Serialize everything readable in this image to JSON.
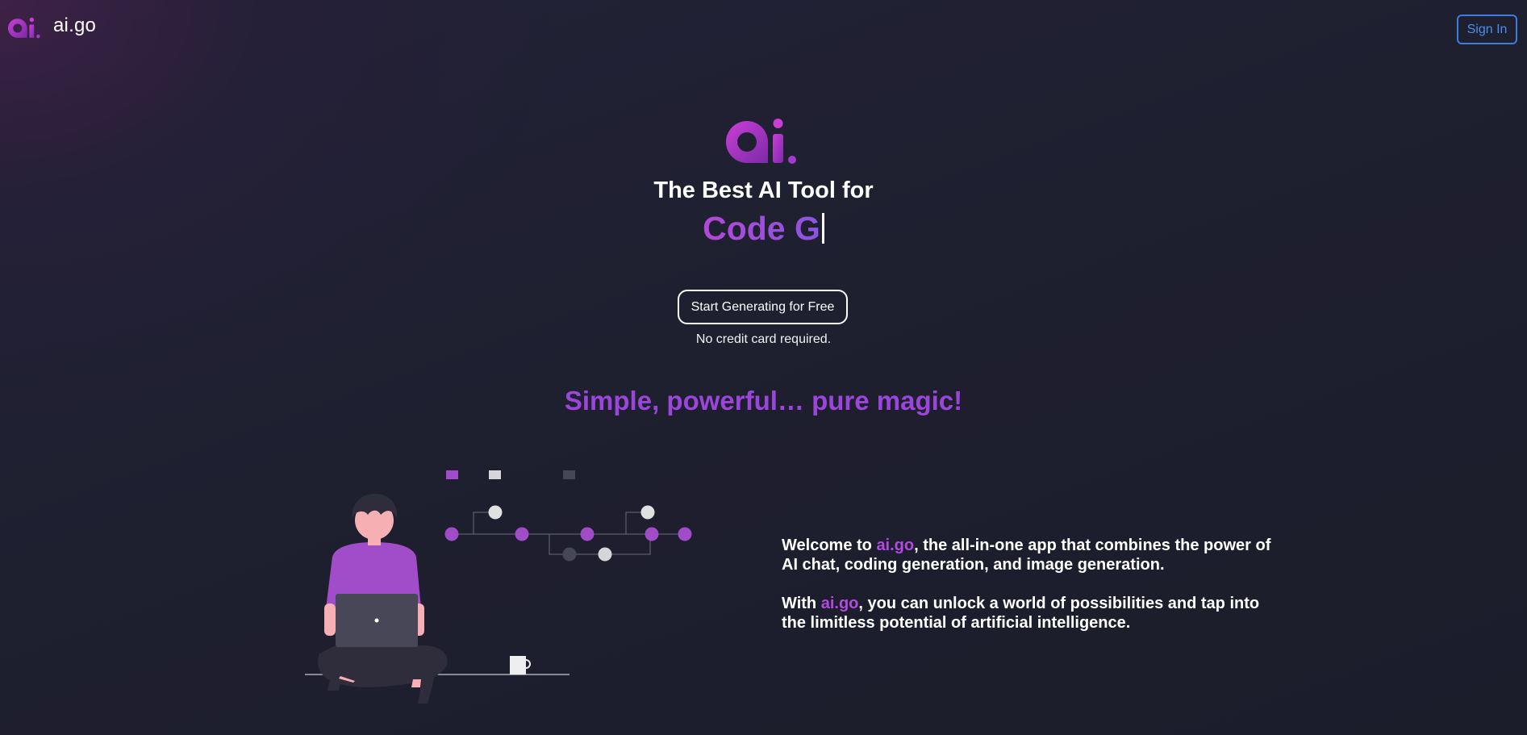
{
  "nav": {
    "logo_icon": "ai-logo-icon",
    "brand": "ai.go",
    "signin_label": "Sign In"
  },
  "hero": {
    "logo_icon": "ai-logo-icon",
    "title": "The Best AI Tool for",
    "typed_text": "Code G",
    "cta_label": "Start Generating for Free",
    "note": "No credit card required."
  },
  "tagline": "Simple, powerful… pure magic!",
  "illustration": {
    "name": "person-with-laptop-illustration"
  },
  "welcome": {
    "p1_prefix": "Welcome to ",
    "p1_brand": "ai.go",
    "p1_suffix": ", the all-in-one app that combines the power of AI chat, coding generation, and image generation.",
    "p2_prefix": "With ",
    "p2_brand": "ai.go",
    "p2_suffix": ", you can unlock a world of possibilities and tap into the limitless potential of artificial intelligence."
  },
  "colors": {
    "brand_purple": "#9b45db",
    "gradient_start": "#b347d8",
    "gradient_end": "#8b55e0",
    "signin_blue": "#3b7ddd",
    "background": "#1e1f2f"
  }
}
